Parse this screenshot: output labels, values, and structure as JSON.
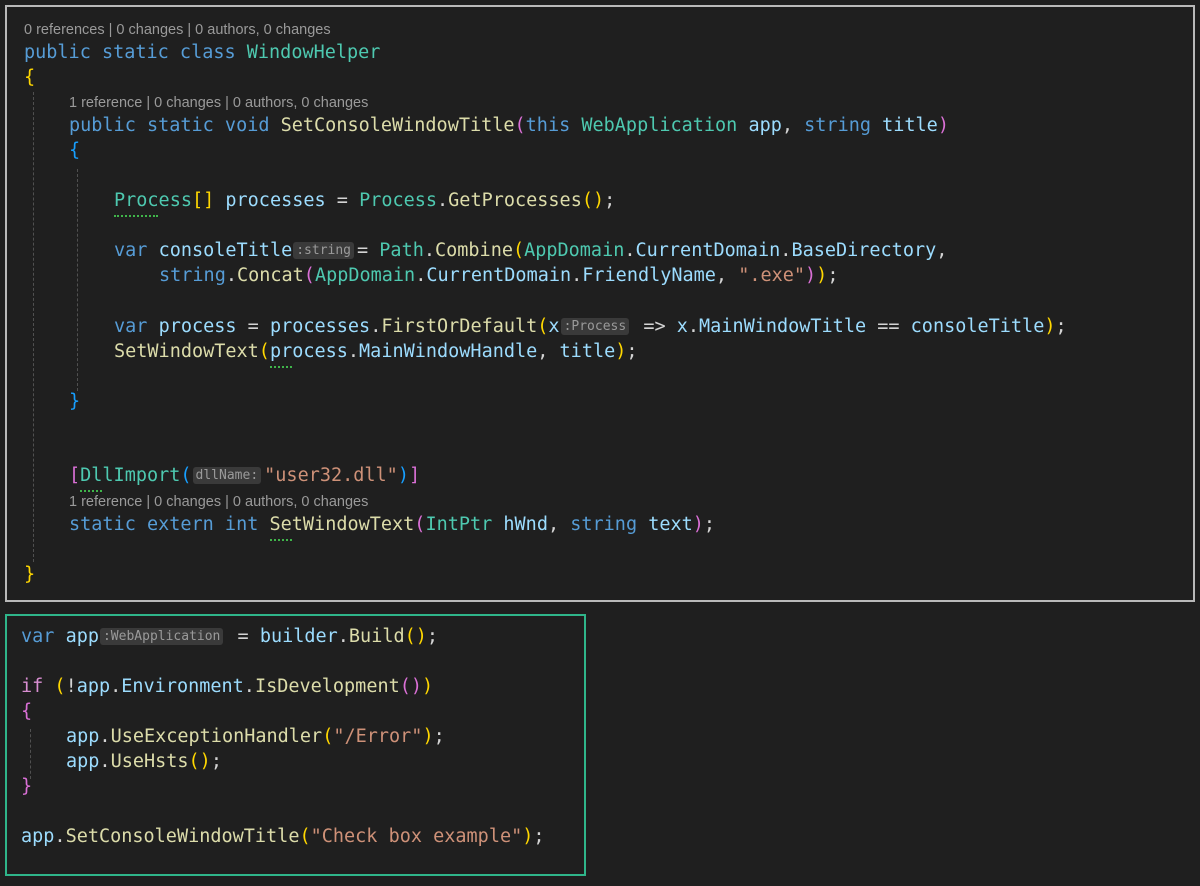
{
  "helper_code": {
    "lens_class": "0 references | 0 changes | 0 authors, 0 changes",
    "class_decl": {
      "kw": "public static class",
      "name": "WindowHelper"
    },
    "open_brace": "{",
    "close_brace": "}",
    "lens_method": "1 reference | 0 changes | 0 authors, 0 changes",
    "method_decl": {
      "kw": "public static void",
      "name": "SetConsoleWindowTitle",
      "this_kw": "this",
      "param_type": "WebApplication",
      "param1": "app",
      "string_kw": "string",
      "param2": "title"
    },
    "method_open": "{",
    "method_close": "}",
    "line_processes": {
      "type": "Process",
      "brackets": "[]",
      "var": "processes",
      "type2": "Process",
      "call": "GetProcesses"
    },
    "line_title": {
      "var_kw": "var",
      "name": "consoleTitle",
      "hint": ":string",
      "cls": "Path",
      "fn": "Combine",
      "cls2": "AppDomain",
      "prop1": "CurrentDomain",
      "prop2": "BaseDirectory"
    },
    "line_concat": {
      "string_kw": "string",
      "fn": "Concat",
      "cls": "AppDomain",
      "prop1": "CurrentDomain",
      "prop2": "FriendlyName",
      "literal": "\".exe\""
    },
    "line_process": {
      "var_kw": "var",
      "name": "process",
      "src": "processes",
      "fn": "FirstOrDefault",
      "lambda_param": "x",
      "hint": ":Process",
      "prop": "MainWindowTitle",
      "cmp": "consoleTitle"
    },
    "line_setwindow": {
      "fn": "SetWindowText",
      "obj": "process",
      "prop": "MainWindowHandle",
      "arg": "title"
    },
    "attribute": {
      "name": "DllImport",
      "hint": "dllName:",
      "literal": "\"user32.dll\""
    },
    "lens_extern": "1 reference | 0 changes | 0 authors, 0 changes",
    "extern_decl": {
      "kw": "static extern int",
      "name": "SetWindowText",
      "type": "IntPtr",
      "p1": "hWnd",
      "string_kw": "string",
      "p2": "text"
    }
  },
  "program_code": {
    "line_build": {
      "var_kw": "var",
      "name": "app",
      "hint": ":WebApplication",
      "obj": "builder",
      "fn": "Build"
    },
    "line_if": {
      "kw": "if",
      "obj": "app",
      "prop": "Environment",
      "fn": "IsDevelopment"
    },
    "open_brace": "{",
    "close_brace": "}",
    "line_handler": {
      "obj": "app",
      "fn": "UseExceptionHandler",
      "literal": "\"/Error\""
    },
    "line_hsts": {
      "obj": "app",
      "fn": "UseHsts"
    },
    "line_title": {
      "obj": "app",
      "fn": "SetConsoleWindowTitle",
      "literal": "\"Check box example\""
    }
  },
  "colors": {
    "background": "#1f1f1f",
    "top_panel_border": "#b9b9b9",
    "bottom_panel_border": "#2fb58a",
    "keyword": "#569cd6",
    "control_keyword": "#d88ed1",
    "type": "#4ec9b0",
    "function": "#dcdcaa",
    "variable": "#9cdcfe",
    "string": "#ce9178",
    "bracket_level1": "#ffd700",
    "bracket_level2": "#da70d6",
    "bracket_level3": "#179fff"
  }
}
